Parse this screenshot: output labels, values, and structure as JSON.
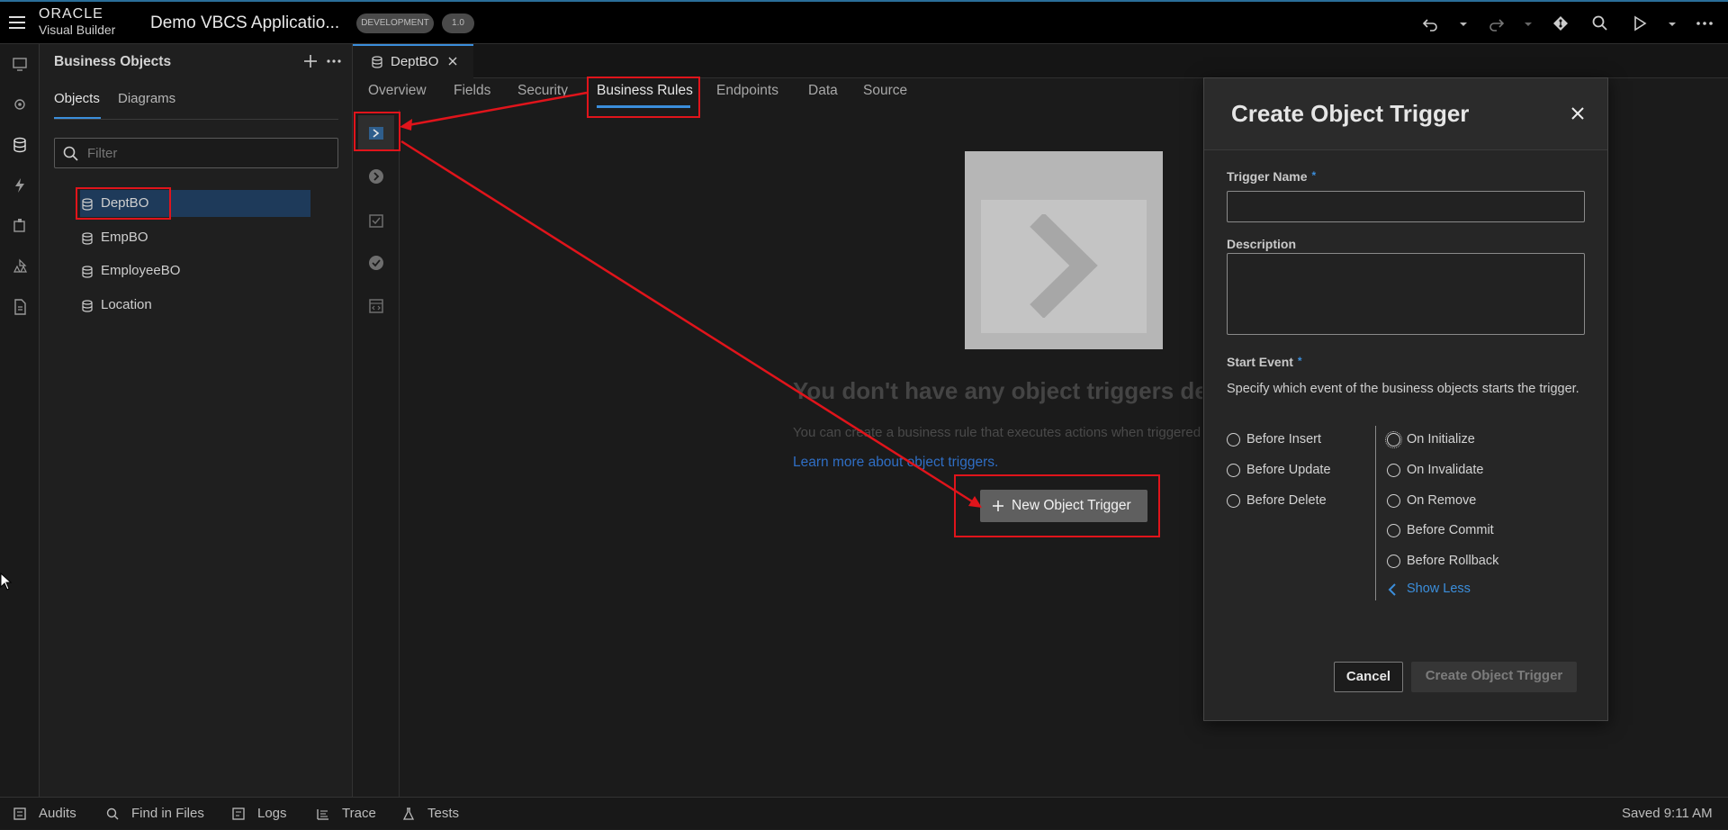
{
  "header": {
    "brand_top": "ORACLE",
    "brand_bottom": "Visual Builder",
    "app_title": "Demo VBCS Applicatio...",
    "env_badge": "DEVELOPMENT",
    "version_badge": "1.0"
  },
  "sidebar": {
    "title": "Business Objects",
    "tabs": [
      "Objects",
      "Diagrams"
    ],
    "filter_placeholder": "Filter",
    "items": [
      "DeptBO",
      "EmpBO",
      "EmployeeBO",
      "Location"
    ]
  },
  "editor": {
    "file_tab": "DeptBO",
    "tabs": [
      "Overview",
      "Fields",
      "Security",
      "Business Rules",
      "Endpoints",
      "Data",
      "Source"
    ],
    "active_tab": "Business Rules",
    "empty_title": "You don't have any object triggers de",
    "empty_desc": "You can create a business rule that executes actions when triggered",
    "learn_more": "Learn more about object triggers.",
    "new_trigger_button": "New Object Trigger"
  },
  "dialog": {
    "title": "Create Object Trigger",
    "trigger_name_label": "Trigger Name",
    "trigger_name_value": "",
    "description_label": "Description",
    "description_value": "",
    "start_event_label": "Start Event",
    "start_event_help": "Specify which event of the business objects starts the trigger.",
    "left_events": [
      "Before Insert",
      "Before Update",
      "Before Delete"
    ],
    "right_events": [
      "On Initialize",
      "On Invalidate",
      "On Remove",
      "Before Commit",
      "Before Rollback"
    ],
    "show_less": "Show Less",
    "cancel_button": "Cancel",
    "create_button": "Create Object Trigger"
  },
  "bottombar": {
    "items": [
      "Audits",
      "Find in Files",
      "Logs",
      "Trace",
      "Tests"
    ],
    "status": "Saved 9:11 AM"
  },
  "colors": {
    "accent": "#3b8edb",
    "annotation": "#e0141b",
    "selected_row": "#1e3a5a"
  }
}
